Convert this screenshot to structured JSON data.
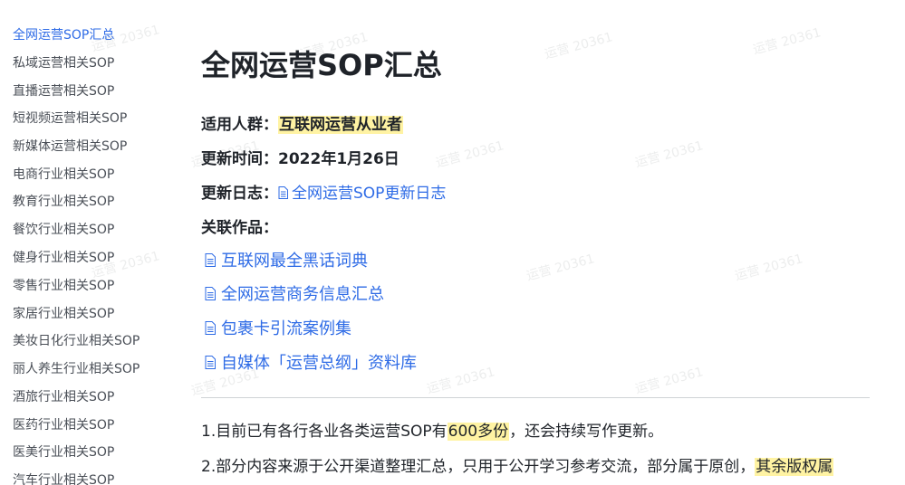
{
  "sidebar": {
    "items": [
      {
        "label": "全网运营SOP汇总",
        "active": true
      },
      {
        "label": "私域运营相关SOP"
      },
      {
        "label": "直播运营相关SOP"
      },
      {
        "label": "短视频运营相关SOP"
      },
      {
        "label": "新媒体运营相关SOP"
      },
      {
        "label": "电商行业相关SOP"
      },
      {
        "label": "教育行业相关SOP"
      },
      {
        "label": "餐饮行业相关SOP"
      },
      {
        "label": "健身行业相关SOP"
      },
      {
        "label": "零售行业相关SOP"
      },
      {
        "label": "家居行业相关SOP"
      },
      {
        "label": "美妆日化行业相关SOP"
      },
      {
        "label": "丽人养生行业相关SOP"
      },
      {
        "label": "酒旅行业相关SOP"
      },
      {
        "label": "医药行业相关SOP"
      },
      {
        "label": "医美行业相关SOP"
      },
      {
        "label": "汽车行业相关SOP"
      }
    ]
  },
  "main": {
    "title": "全网运营SOP汇总",
    "audience_label": "适用人群：",
    "audience_value": "互联网运营从业者",
    "updated_label": "更新时间：",
    "updated_value": "2022年1月26日",
    "log_label": "更新日志：",
    "log_link": "全网运营SOP更新日志",
    "related_label": "关联作品：",
    "related_links": [
      "互联网最全黑话词典",
      "全网运营商务信息汇总",
      "包裹卡引流案例集",
      "自媒体「运营总纲」资料库"
    ],
    "para1_a": "1.目前已有各行各业各类运营SOP有",
    "para1_hl": "600多份",
    "para1_b": "，还会持续写作更新。",
    "para2_a": "2.部分内容来源于公开渠道整理汇总，只用于公开学习参考交流，部分属于原创，",
    "para2_hl": "其余版权属"
  },
  "watermark_text": "运营 20361",
  "colors": {
    "accent": "#2e6be6",
    "highlight": "#fff3a3",
    "text": "#1f2329"
  },
  "icons": {
    "doc": "document-icon"
  }
}
